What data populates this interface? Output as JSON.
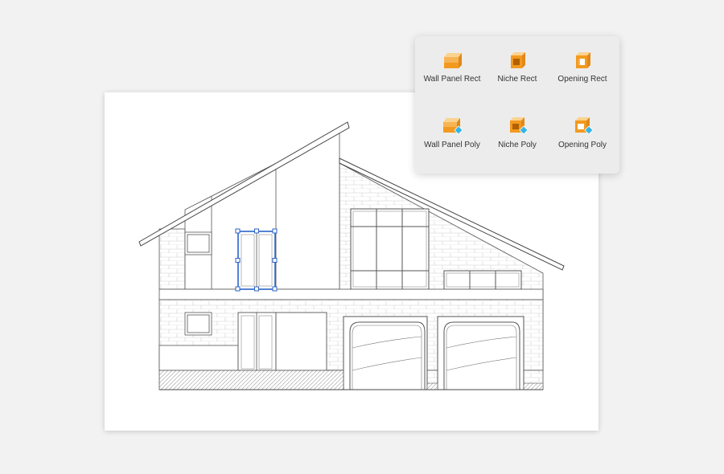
{
  "palette": {
    "tools": [
      {
        "id": "wall-panel-rect",
        "label": "Wall Panel Rect",
        "icon": "wall-panel-rect-icon"
      },
      {
        "id": "niche-rect",
        "label": "Niche Rect",
        "icon": "niche-rect-icon"
      },
      {
        "id": "opening-rect",
        "label": "Opening Rect",
        "icon": "opening-rect-icon"
      },
      {
        "id": "wall-panel-poly",
        "label": "Wall Panel Poly",
        "icon": "wall-panel-poly-icon"
      },
      {
        "id": "niche-poly",
        "label": "Niche Poly",
        "icon": "niche-poly-icon"
      },
      {
        "id": "opening-poly",
        "label": "Opening Poly",
        "icon": "opening-poly-icon"
      }
    ]
  },
  "colors": {
    "accent_orange": "#f29a1f",
    "accent_orange_light": "#f9c476",
    "selection_blue": "#2b63c6",
    "poly_marker": "#33b5e5",
    "line": "#555555"
  }
}
